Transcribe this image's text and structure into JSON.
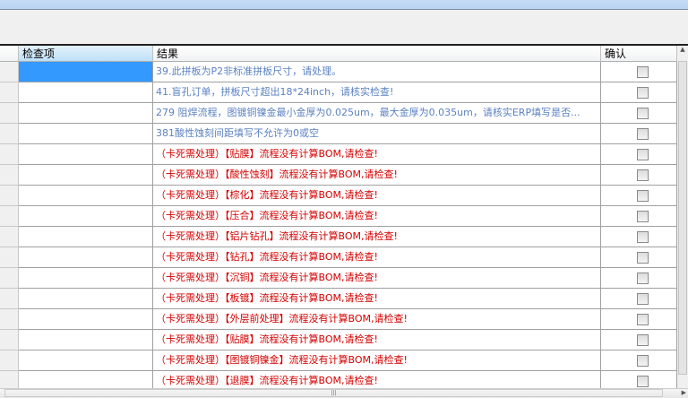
{
  "columns": {
    "item": "检查项",
    "result": "结果",
    "confirm": "确认"
  },
  "rows": [
    {
      "result": "39.此拼板为P2非标准拼板尺寸，请处理。",
      "color": "blue",
      "selected": true
    },
    {
      "result": "41.盲孔订单，拼板尺寸超出18*24inch，请核实检查!",
      "color": "blue"
    },
    {
      "result": "279 阻焊流程，图镀铜镍金最小金厚为0.025um，最大金厚为0.035um，请核实ERP填写是否...",
      "color": "blue"
    },
    {
      "result": "381酸性蚀刻间距填写不允许为0或空",
      "color": "blue"
    },
    {
      "result": "（卡死需处理）【贴膜】流程没有计算BOM,请检查!",
      "color": "red"
    },
    {
      "result": "（卡死需处理）【酸性蚀刻】流程没有计算BOM,请检查!",
      "color": "red"
    },
    {
      "result": "（卡死需处理）【棕化】流程没有计算BOM,请检查!",
      "color": "red"
    },
    {
      "result": "（卡死需处理）【压合】流程没有计算BOM,请检查!",
      "color": "red"
    },
    {
      "result": "（卡死需处理）【铝片钻孔】流程没有计算BOM,请检查!",
      "color": "red"
    },
    {
      "result": "（卡死需处理）【钻孔】流程没有计算BOM,请检查!",
      "color": "red"
    },
    {
      "result": "（卡死需处理）【沉铜】流程没有计算BOM,请检查!",
      "color": "red"
    },
    {
      "result": "（卡死需处理）【板镀】流程没有计算BOM,请检查!",
      "color": "red"
    },
    {
      "result": "（卡死需处理）【外层前处理】流程没有计算BOM,请检查!",
      "color": "red"
    },
    {
      "result": "（卡死需处理）【贴膜】流程没有计算BOM,请检查!",
      "color": "red"
    },
    {
      "result": "（卡死需处理）【图镀铜镍金】流程没有计算BOM,请检查!",
      "color": "red"
    },
    {
      "result": "（卡死需处理）【退膜】流程没有计算BOM,请检查!",
      "color": "red"
    }
  ],
  "colors": {
    "blue": "#5b82c2",
    "red": "#d40000",
    "selection": "#3399ff"
  }
}
